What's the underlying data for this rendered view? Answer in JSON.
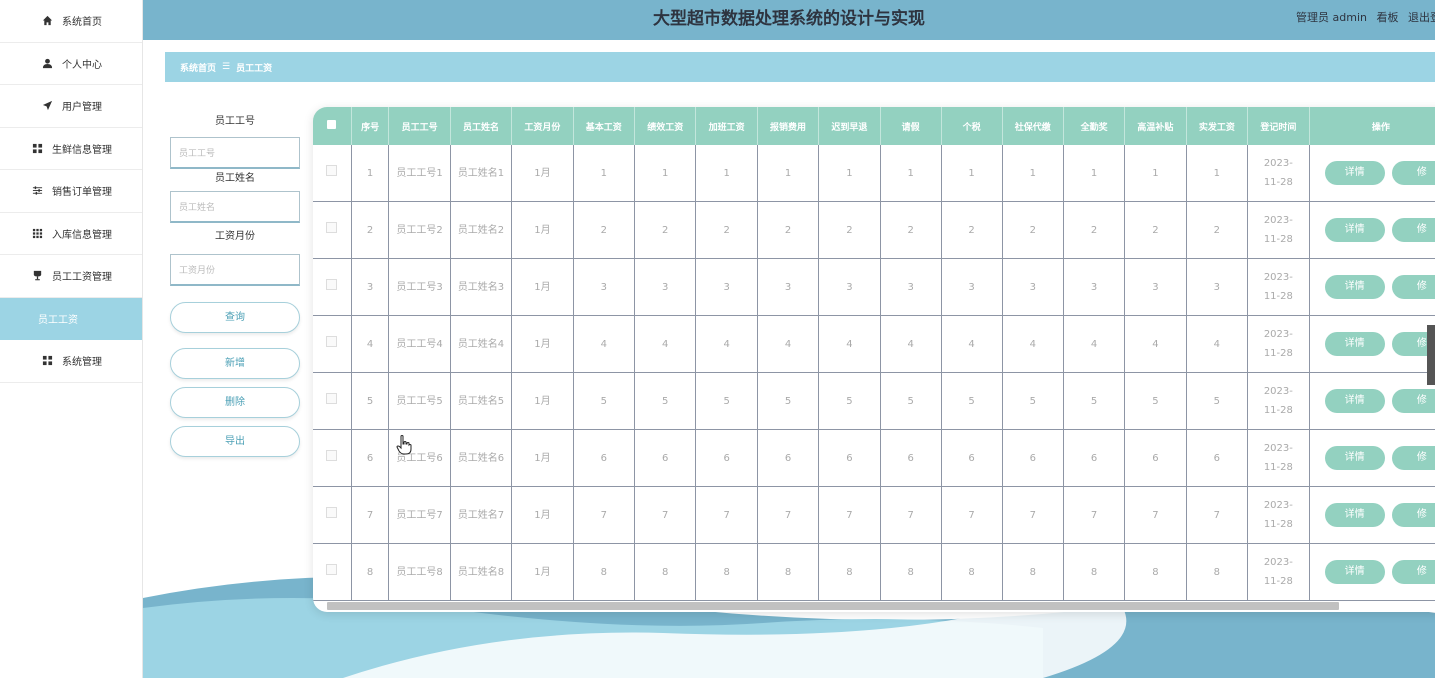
{
  "sidebar": {
    "items": [
      {
        "label": "系统首页",
        "icon": "home-icon"
      },
      {
        "label": "个人中心",
        "icon": "user-icon"
      },
      {
        "label": "用户管理",
        "icon": "send-icon"
      },
      {
        "label": "生鲜信息管理",
        "icon": "grid-icon"
      },
      {
        "label": "销售订单管理",
        "icon": "sliders-icon"
      },
      {
        "label": "入库信息管理",
        "icon": "apps-icon"
      },
      {
        "label": "员工工资管理",
        "icon": "cup-icon"
      },
      {
        "label": "员工工资",
        "icon": "",
        "active": true
      },
      {
        "label": "系统管理",
        "icon": "grid-icon"
      }
    ]
  },
  "header": {
    "title": "大型超市数据处理系统的设计与实现",
    "user_text": "管理员 admin",
    "board": "看板",
    "logout": "退出登"
  },
  "breadcrumb": {
    "home": "系统首页",
    "sep": "☰",
    "current": "员工工资"
  },
  "search": {
    "emp_no_label": "员工工号",
    "emp_no_placeholder": "员工工号",
    "emp_name_label": "员工姓名",
    "emp_name_placeholder": "员工姓名",
    "month_label": "工资月份",
    "month_placeholder": "工资月份",
    "query": "查询",
    "add": "新增",
    "delete": "删除",
    "export": "导出"
  },
  "table": {
    "columns": [
      "序号",
      "员工工号",
      "员工姓名",
      "工资月份",
      "基本工资",
      "绩效工资",
      "加班工资",
      "报销费用",
      "迟到早退",
      "请假",
      "个税",
      "社保代缴",
      "全勤奖",
      "高温补贴",
      "实发工资",
      "登记时间",
      "操作"
    ],
    "detail_btn": "详情",
    "edit_btn": "修",
    "rows": [
      {
        "no": "1",
        "emp_no": "员工工号1",
        "emp_name": "员工姓名1",
        "month": "1月",
        "v": [
          "1",
          "1",
          "1",
          "1",
          "1",
          "1",
          "1",
          "1",
          "1",
          "1",
          "1"
        ],
        "time": "2023-11-28"
      },
      {
        "no": "2",
        "emp_no": "员工工号2",
        "emp_name": "员工姓名2",
        "month": "1月",
        "v": [
          "2",
          "2",
          "2",
          "2",
          "2",
          "2",
          "2",
          "2",
          "2",
          "2",
          "2"
        ],
        "time": "2023-11-28"
      },
      {
        "no": "3",
        "emp_no": "员工工号3",
        "emp_name": "员工姓名3",
        "month": "1月",
        "v": [
          "3",
          "3",
          "3",
          "3",
          "3",
          "3",
          "3",
          "3",
          "3",
          "3",
          "3"
        ],
        "time": "2023-11-28"
      },
      {
        "no": "4",
        "emp_no": "员工工号4",
        "emp_name": "员工姓名4",
        "month": "1月",
        "v": [
          "4",
          "4",
          "4",
          "4",
          "4",
          "4",
          "4",
          "4",
          "4",
          "4",
          "4"
        ],
        "time": "2023-11-28"
      },
      {
        "no": "5",
        "emp_no": "员工工号5",
        "emp_name": "员工姓名5",
        "month": "1月",
        "v": [
          "5",
          "5",
          "5",
          "5",
          "5",
          "5",
          "5",
          "5",
          "5",
          "5",
          "5"
        ],
        "time": "2023-11-28"
      },
      {
        "no": "6",
        "emp_no": "员工工号6",
        "emp_name": "员工姓名6",
        "month": "1月",
        "v": [
          "6",
          "6",
          "6",
          "6",
          "6",
          "6",
          "6",
          "6",
          "6",
          "6",
          "6"
        ],
        "time": "2023-11-28"
      },
      {
        "no": "7",
        "emp_no": "员工工号7",
        "emp_name": "员工姓名7",
        "month": "1月",
        "v": [
          "7",
          "7",
          "7",
          "7",
          "7",
          "7",
          "7",
          "7",
          "7",
          "7",
          "7"
        ],
        "time": "2023-11-28"
      },
      {
        "no": "8",
        "emp_no": "员工工号8",
        "emp_name": "员工姓名8",
        "month": "1月",
        "v": [
          "8",
          "8",
          "8",
          "8",
          "8",
          "8",
          "8",
          "8",
          "8",
          "8",
          "8"
        ],
        "time": "2023-11-28"
      }
    ]
  },
  "colors": {
    "header": "#78b4cc",
    "accent": "#9cd4e4",
    "table_head": "#93d1c0"
  }
}
